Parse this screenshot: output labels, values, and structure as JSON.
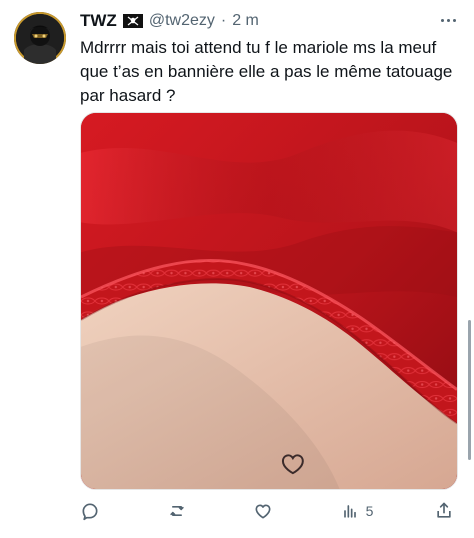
{
  "tweet": {
    "display_name": "TWZ",
    "handle": "@tw2ezy",
    "separator": "·",
    "time": "2 m",
    "text": "Mdrrrr mais toi attend tu f le mariole ms la meuf que t’as en bannière elle a pas le même tatouage par hasard ?",
    "icons": {
      "flag": "pirate-flag-icon",
      "more": "more-icon",
      "avatar": "avatar"
    },
    "media": {
      "description_colors": {
        "primary": "#c4161c",
        "dark": "#7a0a0f",
        "skin": "#e7c3ad"
      }
    },
    "actions": {
      "reply_count": "",
      "retweet_count": "",
      "like_count": "",
      "views_count": "5",
      "share_label": ""
    }
  }
}
